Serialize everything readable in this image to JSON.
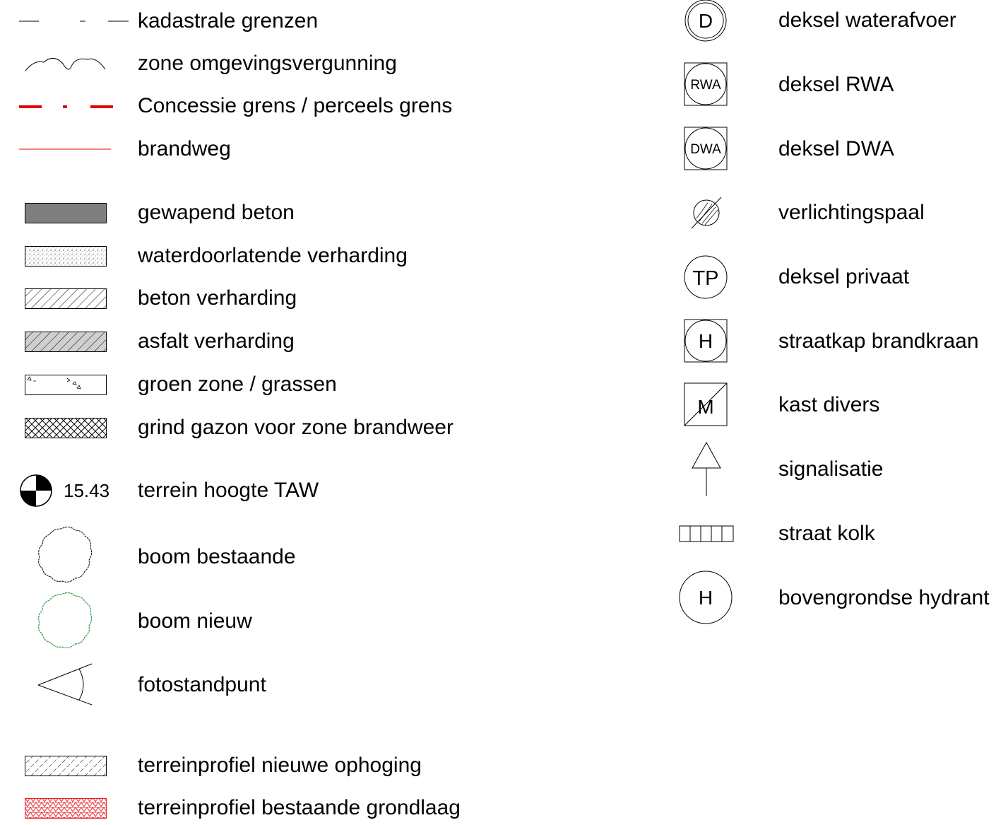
{
  "legend_left": {
    "kadastrale_grenzen": "kadastrale grenzen",
    "zone_omgevingsvergunning": "zone omgevingsvergunning",
    "concessie_grens": "Concessie grens / perceels grens",
    "brandweg": "brandweg",
    "gewapend_beton": "gewapend beton",
    "waterdoorlatende_verharding": "waterdoorlatende verharding",
    "beton_verharding": "beton verharding",
    "asfalt_verharding": "asfalt verharding",
    "groen_zone": "groen zone / grassen",
    "grind_gazon": "grind gazon voor zone brandweer",
    "terrein_hoogte": "terrein hoogte TAW",
    "terrein_hoogte_value": "15.43",
    "boom_bestaande": "boom bestaande",
    "boom_nieuw": "boom nieuw",
    "fotostandpunt": "fotostandpunt",
    "terreinprofiel_nieuwe_ophoging": "terreinprofiel nieuwe ophoging",
    "terreinprofiel_bestaande_grondlaag": "terreinprofiel bestaande grondlaag"
  },
  "legend_right": {
    "deksel_waterafvoer": "deksel waterafvoer",
    "deksel_waterafvoer_symbol": "D",
    "deksel_rwa": "deksel RWA",
    "deksel_rwa_symbol": "RWA",
    "deksel_dwa": "deksel DWA",
    "deksel_dwa_symbol": "DWA",
    "verlichtingspaal": "verlichtingspaal",
    "deksel_privaat": "deksel privaat",
    "deksel_privaat_symbol": "TP",
    "straatkap_brandkraan": "straatkap brandkraan",
    "straatkap_brandkraan_symbol": "H",
    "kast_divers": "kast divers",
    "kast_divers_symbol": "M",
    "signalisatie": "signalisatie",
    "straat_kolk": "straat kolk",
    "bovengrondse_hydrant": "bovengrondse hydrant",
    "bovengrondse_hydrant_symbol": "H"
  },
  "colors": {
    "concessie_red": "#e60000",
    "brandweg_red": "#e60000",
    "gewapend_beton_fill": "#7f7f7f",
    "asfalt_fill": "#cfcfcf",
    "boom_nieuw_green": "#2e9a4a",
    "grondlaag_red": "#e8202a"
  }
}
